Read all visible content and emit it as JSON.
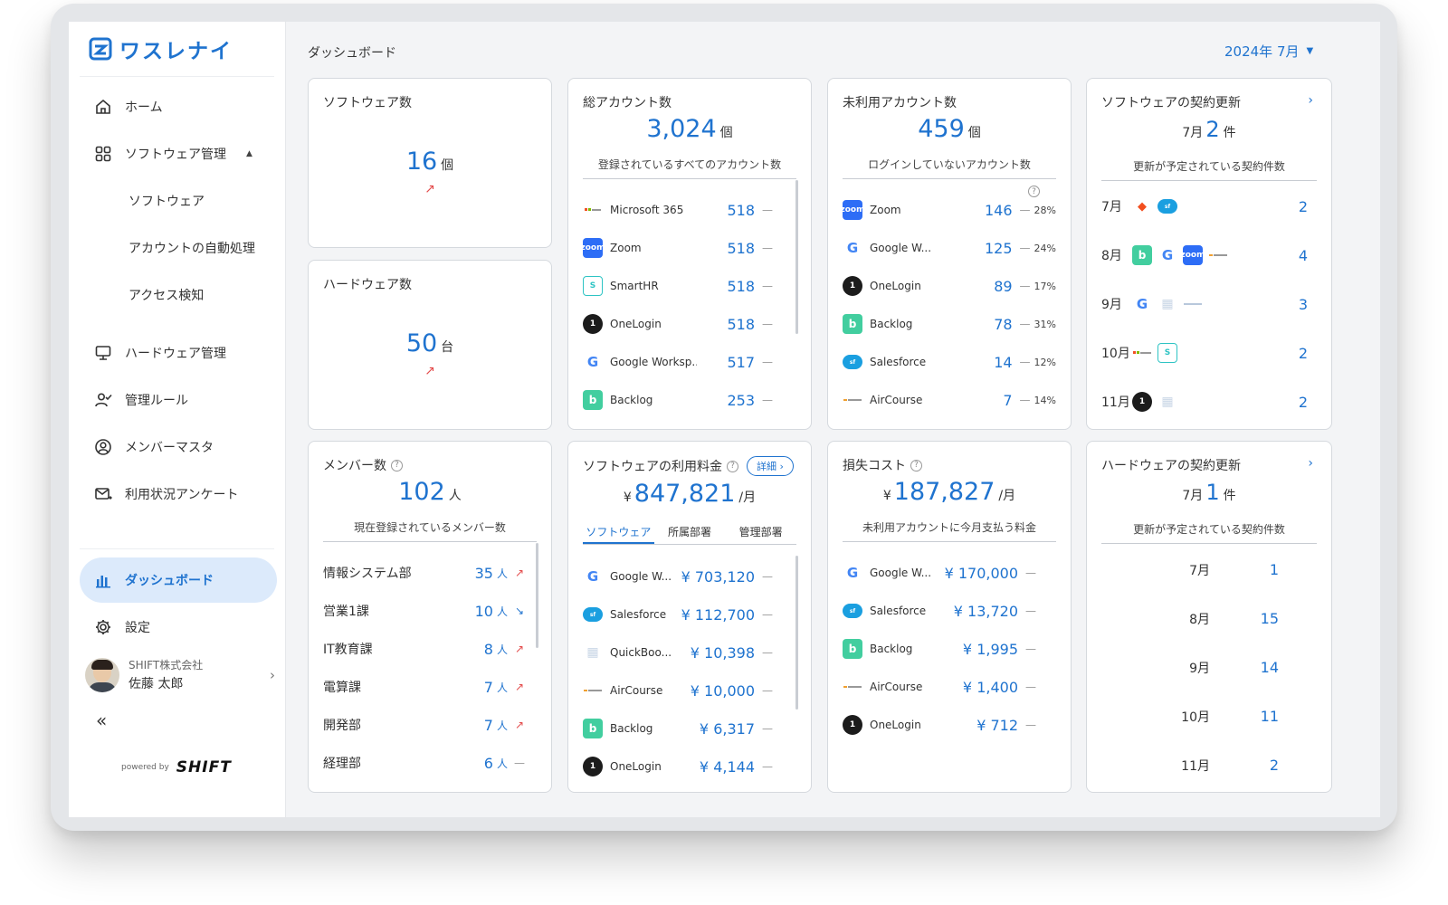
{
  "brand": {
    "name": "ワスレナイ",
    "powered_by": "powered by",
    "powered_brand": "SHIFT"
  },
  "header": {
    "title": "ダッシュボード",
    "month": "2024年 7月"
  },
  "sidebar": {
    "items": [
      {
        "label": "ホーム",
        "icon": "home-icon"
      },
      {
        "label": "ソフトウェア管理",
        "icon": "grid-icon"
      },
      {
        "label": "ソフトウェア"
      },
      {
        "label": "アカウントの自動処理"
      },
      {
        "label": "アクセス検知"
      },
      {
        "label": "ハードウェア管理",
        "icon": "monitor-icon"
      },
      {
        "label": "管理ルール",
        "icon": "user-check-icon"
      },
      {
        "label": "メンバーマスタ",
        "icon": "user-circle-icon"
      },
      {
        "label": "利用状況アンケート",
        "icon": "mail-icon"
      }
    ],
    "active": "ダッシュボード",
    "settings": "設定",
    "user": {
      "company": "SHIFT株式会社",
      "name": "佐藤 太郎"
    },
    "collapse": "«"
  },
  "cards": {
    "software_count": {
      "title": "ソフトウェア数",
      "value": "16",
      "unit": "個",
      "trend": "↗"
    },
    "hardware_count": {
      "title": "ハードウェア数",
      "value": "50",
      "unit": "台",
      "trend": "↗"
    },
    "total_accounts": {
      "title": "総アカウント数",
      "value": "3,024",
      "unit": "個",
      "subtitle": "登録されているすべてのアカウント数",
      "rows": [
        {
          "name": "Microsoft 365",
          "value": "518"
        },
        {
          "name": "Zoom",
          "value": "518"
        },
        {
          "name": "SmartHR",
          "value": "518"
        },
        {
          "name": "OneLogin",
          "value": "518"
        },
        {
          "name": "Google Worksp...",
          "value": "517"
        },
        {
          "name": "Backlog",
          "value": "253"
        }
      ]
    },
    "unused_accounts": {
      "title": "未利用アカウント数",
      "value": "459",
      "unit": "個",
      "subtitle": "ログインしていないアカウント数",
      "rows": [
        {
          "name": "Zoom",
          "value": "146",
          "pct": "28%"
        },
        {
          "name": "Google W...",
          "value": "125",
          "pct": "24%"
        },
        {
          "name": "OneLogin",
          "value": "89",
          "pct": "17%"
        },
        {
          "name": "Backlog",
          "value": "78",
          "pct": "31%"
        },
        {
          "name": "Salesforce",
          "value": "14",
          "pct": "12%"
        },
        {
          "name": "AirCourse",
          "value": "7",
          "pct": "14%"
        }
      ]
    },
    "sw_renewal": {
      "title": "ソフトウェアの契約更新",
      "month": "7月",
      "value": "2",
      "unit": "件",
      "subtitle": "更新が予定されている契約件数",
      "rows": [
        {
          "month": "7月",
          "count": "2"
        },
        {
          "month": "8月",
          "count": "4"
        },
        {
          "month": "9月",
          "count": "3"
        },
        {
          "month": "10月",
          "count": "2"
        },
        {
          "month": "11月",
          "count": "2"
        }
      ]
    },
    "members": {
      "title": "メンバー数",
      "value": "102",
      "unit": "人",
      "subtitle": "現在登録されているメンバー数",
      "rows": [
        {
          "name": "情報システム部",
          "value": "35",
          "unit": "人",
          "trend": "↗"
        },
        {
          "name": "営業1課",
          "value": "10",
          "unit": "人",
          "trend": "↘"
        },
        {
          "name": "IT教育課",
          "value": "8",
          "unit": "人",
          "trend": "↗"
        },
        {
          "name": "電算課",
          "value": "7",
          "unit": "人",
          "trend": "↗"
        },
        {
          "name": "開発部",
          "value": "7",
          "unit": "人",
          "trend": "↗"
        },
        {
          "name": "経理部",
          "value": "6",
          "unit": "人",
          "trend": "—"
        }
      ]
    },
    "sw_fee": {
      "title": "ソフトウェアの利用料金",
      "detail": "詳細 ›",
      "currency": "¥",
      "value": "847,821",
      "unit": "/月",
      "tabs": [
        "ソフトウェア",
        "所属部署",
        "管理部署"
      ],
      "rows": [
        {
          "name": "Google W...",
          "value": "¥ 703,120"
        },
        {
          "name": "Salesforce",
          "value": "¥ 112,700"
        },
        {
          "name": "QuickBoo...",
          "value": "¥ 10,398"
        },
        {
          "name": "AirCourse",
          "value": "¥ 10,000"
        },
        {
          "name": "Backlog",
          "value": "¥ 6,317"
        },
        {
          "name": "OneLogin",
          "value": "¥ 4,144"
        }
      ]
    },
    "loss_cost": {
      "title": "損失コスト",
      "currency": "¥",
      "value": "187,827",
      "unit": "/月",
      "subtitle": "未利用アカウントに今月支払う料金",
      "rows": [
        {
          "name": "Google W...",
          "value": "¥ 170,000"
        },
        {
          "name": "Salesforce",
          "value": "¥ 13,720"
        },
        {
          "name": "Backlog",
          "value": "¥ 1,995"
        },
        {
          "name": "AirCourse",
          "value": "¥ 1,400"
        },
        {
          "name": "OneLogin",
          "value": "¥ 712"
        }
      ]
    },
    "hw_renewal": {
      "title": "ハードウェアの契約更新",
      "month": "7月",
      "value": "1",
      "unit": "件",
      "subtitle": "更新が予定されている契約件数",
      "rows": [
        {
          "month": "7月",
          "count": "1"
        },
        {
          "month": "8月",
          "count": "15"
        },
        {
          "month": "9月",
          "count": "14"
        },
        {
          "month": "10月",
          "count": "11"
        },
        {
          "month": "11月",
          "count": "2"
        }
      ]
    }
  },
  "colors": {
    "accent": "#1f73cf",
    "active_bg": "#dceafb",
    "trend_up": "#e34b4b"
  }
}
